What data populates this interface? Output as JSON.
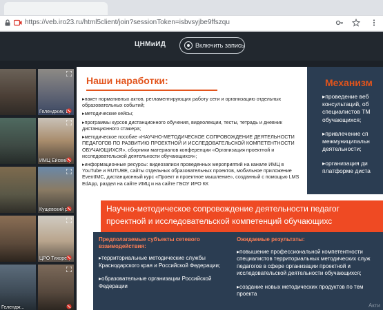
{
  "browser": {
    "url": "https://veb.iro23.ru/html5client/join?sessionToken=isbvsyjbe9ffszqu",
    "icons": [
      "lock-icon",
      "camera-icon",
      "key-icon",
      "star-icon",
      "menu-icon"
    ]
  },
  "toolbar": {
    "org_label": "ЦНМиИД",
    "record_label": "Включить запись"
  },
  "participants": [
    {
      "name": ""
    },
    {
      "name": "Гелендж..."
    },
    {
      "name": "Геленджик, Ц..."
    },
    {
      "name": ""
    },
    {
      "name": "ИМЦ Ейский р..."
    },
    {
      "name": ""
    },
    {
      "name": ""
    },
    {
      "name": "Кущевский ра..."
    },
    {
      "name": ""
    },
    {
      "name": "ЦРО Тихорец..."
    }
  ],
  "slide": {
    "left_title": "Наши наработки:",
    "right_title": "Механизм",
    "work_items": [
      "пакет нормативных актов, регламентирующих работу сети и организацию отдельных образовательных событий;",
      "методические кейсы;",
      "программы курсов дистанционного обучения, видеолекции, тесты, тетрадь и дневник дистанционного стажера;",
      "методическое пособие «НАУЧНО-МЕТОДИЧЕСКОЕ СОПРОВОЖДЕНИЕ ДЕЯТЕЛЬНОСТИ ПЕДАГОГОВ ПО РАЗВИТИЮ ПРОЕКТНОЙ И ИССЛЕДОВАТЕЛЬСКОЙ КОМПЕТЕНТНОСТИ ОБУЧАЮЩИХСЯ», сборники материалов конференции «Организация проектной и исследовательской деятельности обучающихся»;",
      "информационные ресурсы: видеозаписи проведенных мероприятий на канале ИМЦ в YouTube и RUTUBE, сайты отдельных образовательных проектов, мобильное приложение EventIMC, дистанционный курс «Проект и проектное мышление», созданный с помощью LMS EdApp, раздел на сайте ИМЦ и на сайте ГБОУ ИРО КК"
    ],
    "mechanism_items": [
      "проведение веб консультаций, об специалистов ТМ обучающихся;",
      "привлечение сп межмуниципальн деятельности;",
      "организация ди платформе диста"
    ],
    "banner_lines": [
      "Научно-методическое сопровождение деятельности педагог",
      "проектной и исследовательской компетенций обучающихс"
    ],
    "subjects_title": "Предполагаемые субъекты сетевого взаимодействия:",
    "subjects_items": [
      "территориальные методические службы Краснодарского края и Российской Федерации;",
      "образовательные организации Российской Федерации"
    ],
    "results_title": "Ожидаемые результаты:",
    "results_items": [
      "повышение профессиональной компетентности специалистов территориальных методических служ педагогов в сфере организации проектной и исследовательской деятельности обучающихся;",
      "создание новых методических продуктов по тем проекта"
    ],
    "watermark": "Акти"
  }
}
